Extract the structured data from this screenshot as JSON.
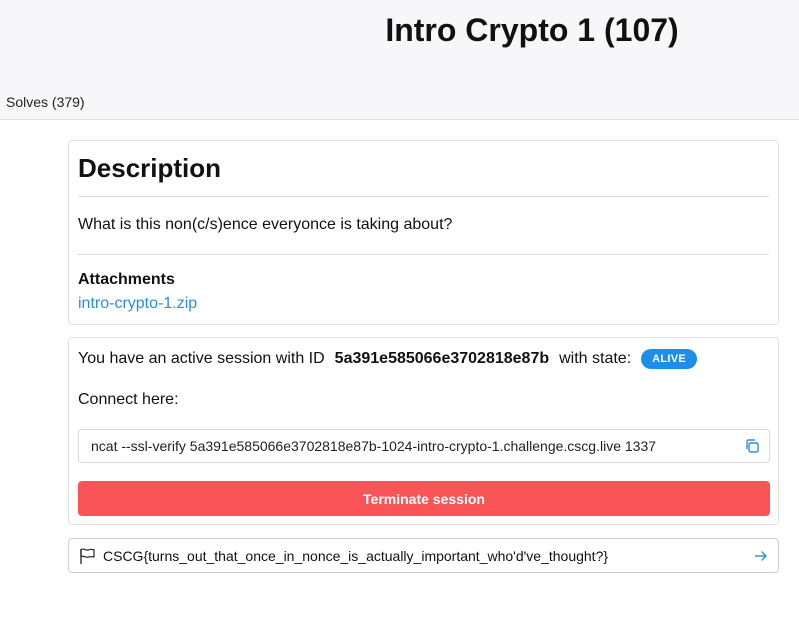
{
  "header": {
    "title": "Intro Crypto 1 (107)",
    "solves_tab": "Solves (379)"
  },
  "description": {
    "heading": "Description",
    "text": "What is this non(c/s)ence everyonce is taking about?",
    "attachments_heading": "Attachments",
    "attachment_link": "intro-crypto-1.zip"
  },
  "session": {
    "prefix": "You have an active session with ID",
    "id": "5a391e585066e3702818e87b",
    "state_label": "with state:",
    "state": "ALIVE",
    "connect_label": "Connect here:",
    "command": "ncat --ssl-verify 5a391e585066e3702818e87b-1024-intro-crypto-1.challenge.cscg.live 1337",
    "terminate_label": "Terminate session"
  },
  "flag": {
    "value": "CSCG{turns_out_that_once_in_nonce_is_actually_important_who'd've_thought?}"
  },
  "colors": {
    "accent": "#2b8fd8",
    "badge": "#1e8ee8",
    "danger": "#f95457"
  },
  "icons": {
    "copy": "copy-icon",
    "flag": "flag-icon",
    "submit": "arrow-right-icon"
  }
}
